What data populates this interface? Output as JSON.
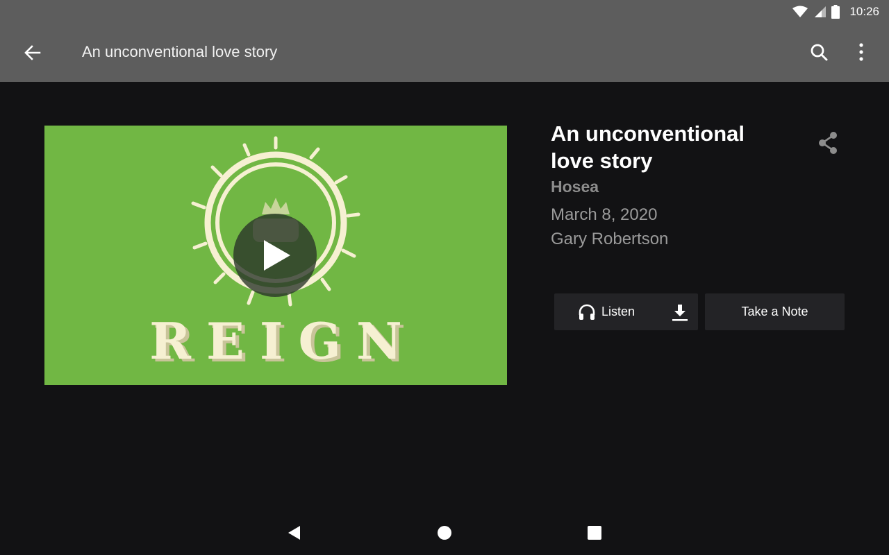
{
  "status_bar": {
    "time": "10:26",
    "icons": [
      "wifi-icon",
      "signal-icon",
      "battery-icon"
    ]
  },
  "app_bar": {
    "title": "An unconventional love story",
    "back_icon": "arrow-back-icon",
    "search_icon": "search-icon",
    "more_icon": "more-vert-icon"
  },
  "artwork": {
    "series_logo_text": "REIGN",
    "background_color": "#71b744",
    "play_icon": "play-icon"
  },
  "sermon": {
    "title": "An unconventional love story",
    "series": "Hosea",
    "date": "March 8, 2020",
    "speaker": "Gary Robertson"
  },
  "actions": {
    "listen_label": "Listen",
    "take_note_label": "Take a Note",
    "share_icon": "share-icon",
    "headphones_icon": "headphones-icon",
    "download_icon": "download-icon"
  },
  "colors": {
    "app_bar": "#5d5d5d",
    "background": "#121214",
    "button": "#232326",
    "muted_text": "#9a9a9a"
  }
}
